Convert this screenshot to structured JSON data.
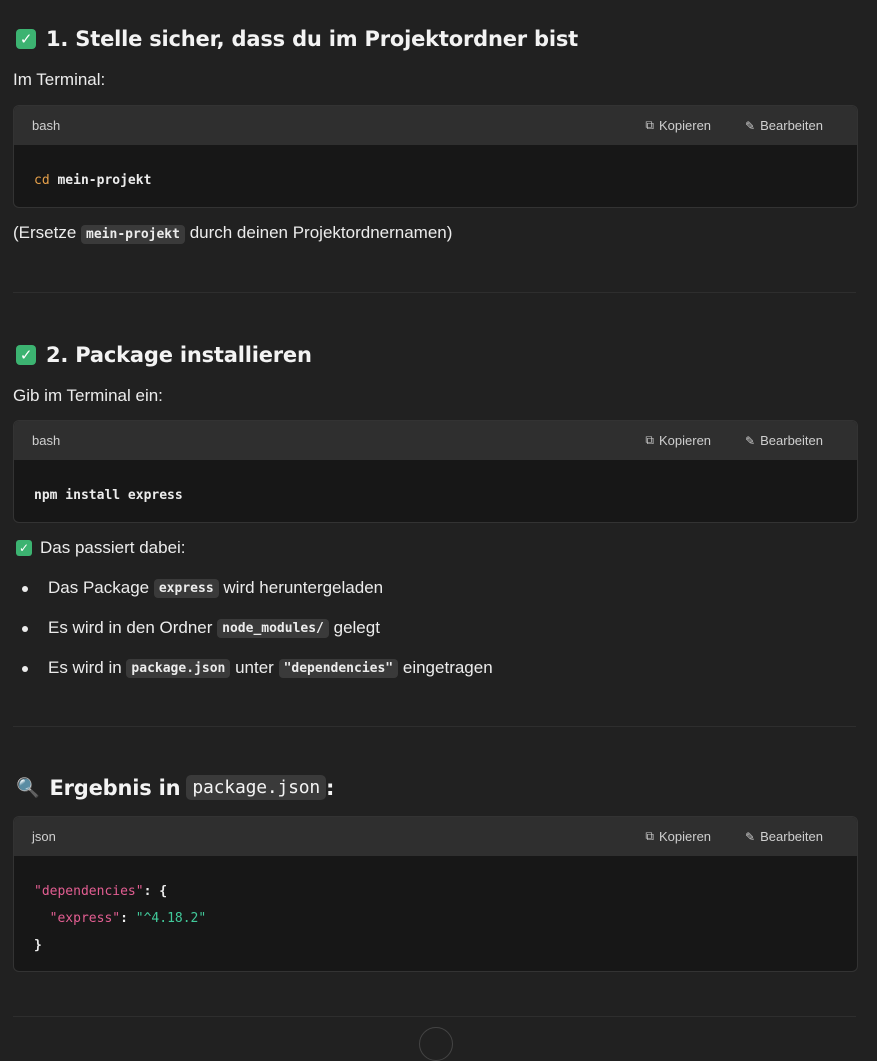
{
  "section1": {
    "heading": "1. Stelle sicher, dass du im Projektordner bist",
    "intro": "Im Terminal:",
    "code": {
      "lang": "bash",
      "copy_label": "Kopieren",
      "edit_label": "Bearbeiten",
      "keyword": "cd",
      "arg": "mein-projekt"
    },
    "note_prefix": "(Ersetze",
    "note_code": "mein-projekt",
    "note_suffix": "durch deinen Projektordnernamen)"
  },
  "section2": {
    "heading": "2. Package installieren",
    "intro": "Gib im Terminal ein:",
    "code": {
      "lang": "bash",
      "copy_label": "Kopieren",
      "edit_label": "Bearbeiten",
      "line": "npm install express"
    },
    "happens_label": "Das passiert dabei:",
    "bullets": [
      {
        "pre": "Das Package",
        "code": "express",
        "post": "wird heruntergeladen"
      },
      {
        "pre": "Es wird in den Ordner",
        "code": "node_modules/",
        "post": "gelegt"
      },
      {
        "pre": "Es wird in",
        "code": "package.json",
        "mid": "unter",
        "code2": "\"dependencies\"",
        "post": "eingetragen"
      }
    ]
  },
  "section3": {
    "heading_text": "Ergebnis in",
    "heading_code": "package.json",
    "heading_suffix": ":",
    "code": {
      "lang": "json",
      "copy_label": "Kopieren",
      "edit_label": "Bearbeiten",
      "key1": "\"dependencies\"",
      "punct1": ": {",
      "key2": "\"express\"",
      "punct2": ": ",
      "val2": "\"^4.18.2\"",
      "close": "}"
    }
  },
  "icons": {
    "check": "check-icon",
    "copy": "copy-icon",
    "edit": "pencil-icon",
    "search": "magnifier-icon"
  },
  "colors": {
    "background": "#212121",
    "check": "#3cb371",
    "keyword": "#e5a04a",
    "json_key": "#e35e92",
    "json_string": "#41c99a"
  }
}
